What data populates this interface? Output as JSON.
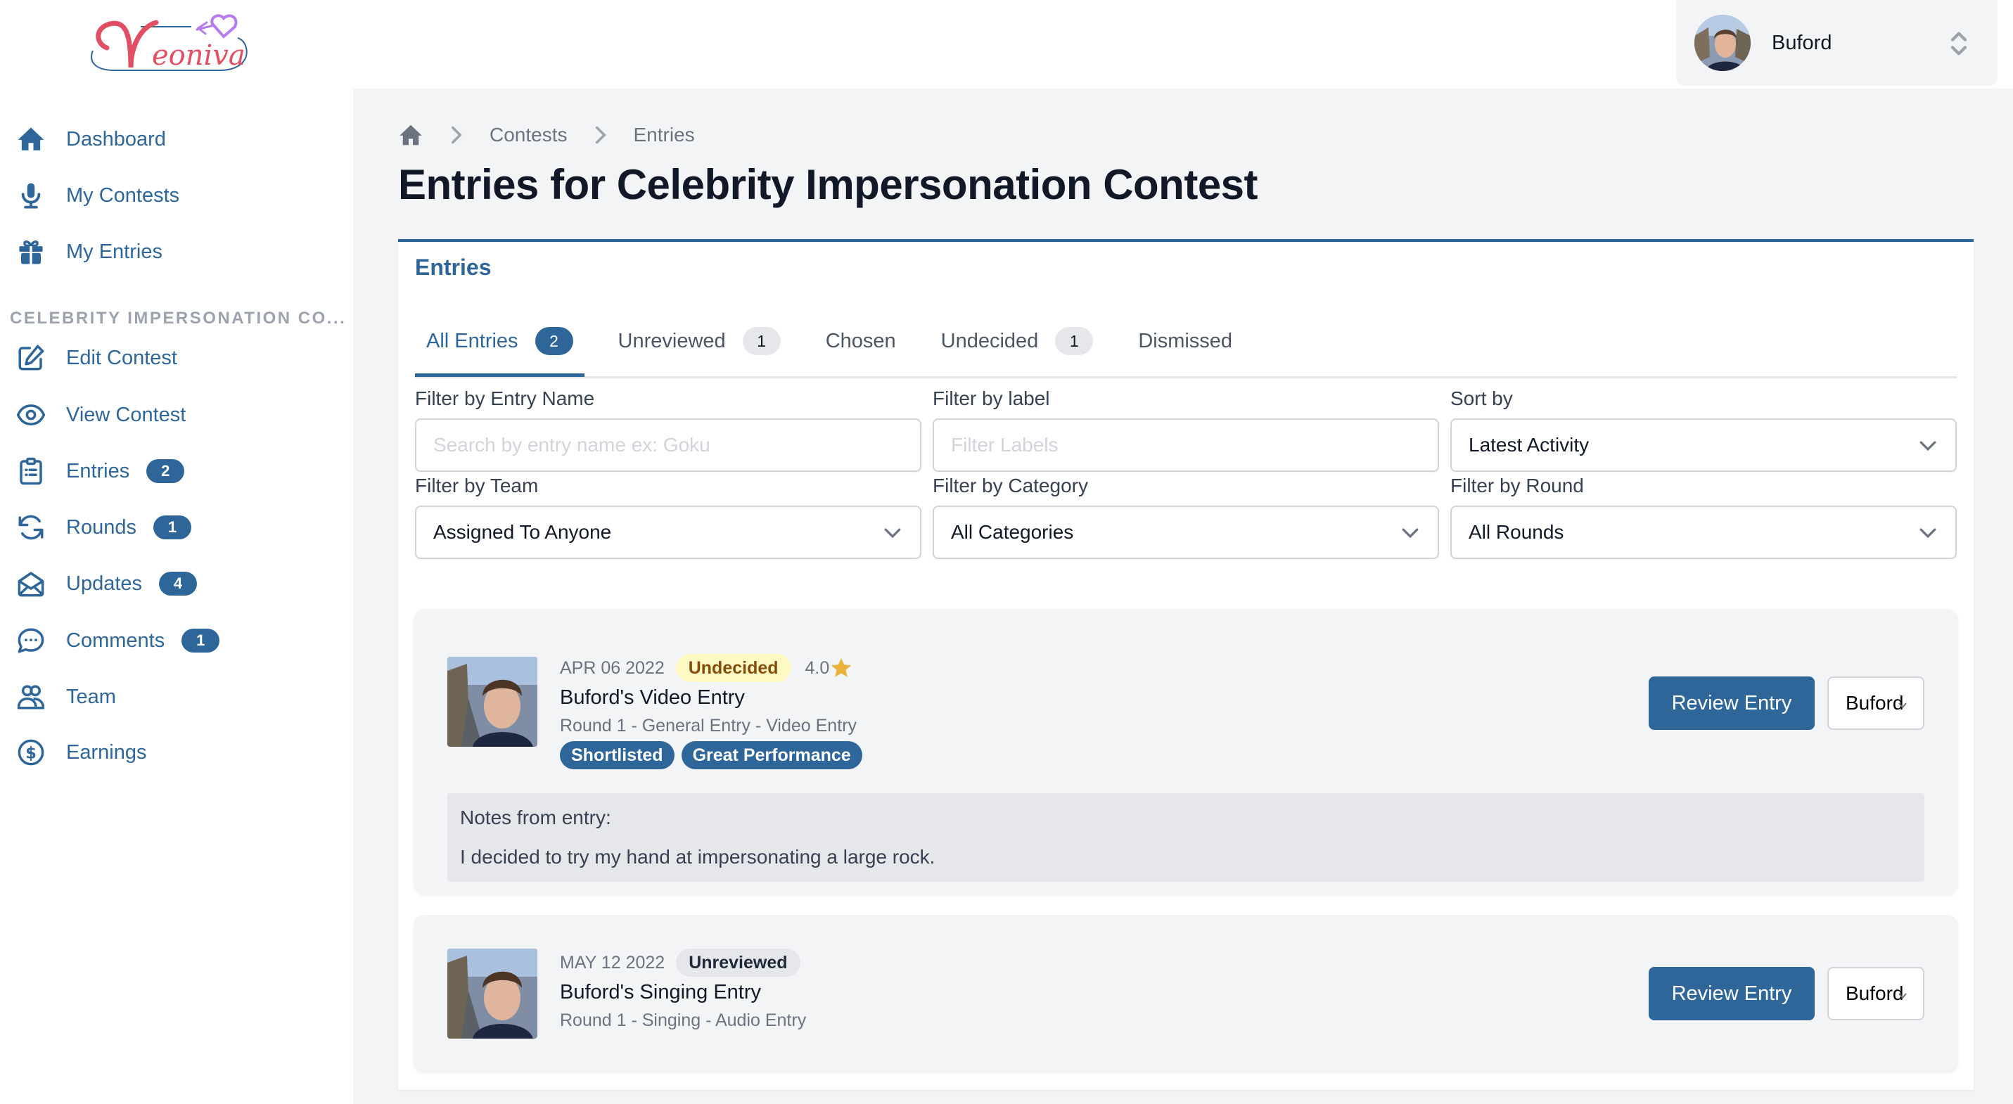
{
  "brand": {
    "name": "Neoniva",
    "colors": {
      "primary": "#2e6699",
      "logo_red": "#e04f63",
      "logo_purple": "#b57cf0"
    }
  },
  "sidebar": {
    "main_items": [
      {
        "label": "Dashboard",
        "icon": "home-icon"
      },
      {
        "label": "My Contests",
        "icon": "microphone-icon"
      },
      {
        "label": "My Entries",
        "icon": "gift-icon"
      }
    ],
    "section_title": "CELEBRITY IMPERSONATION CO...",
    "contest_items": [
      {
        "label": "Edit Contest",
        "icon": "edit-icon"
      },
      {
        "label": "View Contest",
        "icon": "eye-icon"
      },
      {
        "label": "Entries",
        "icon": "clipboard-list-icon",
        "badge": "2"
      },
      {
        "label": "Rounds",
        "icon": "refresh-icon",
        "badge": "1"
      },
      {
        "label": "Updates",
        "icon": "envelope-open-icon",
        "badge": "4"
      },
      {
        "label": "Comments",
        "icon": "chat-bubble-icon",
        "badge": "1"
      },
      {
        "label": "Team",
        "icon": "users-icon"
      },
      {
        "label": "Earnings",
        "icon": "dollar-circle-icon"
      }
    ]
  },
  "user_menu": {
    "name": "Buford"
  },
  "breadcrumb": {
    "items": [
      "Contests",
      "Entries"
    ]
  },
  "page": {
    "title": "Entries for Celebrity Impersonation Contest"
  },
  "panel": {
    "heading": "Entries",
    "tabs": [
      {
        "label": "All Entries",
        "count": "2",
        "active": true
      },
      {
        "label": "Unreviewed",
        "count": "1"
      },
      {
        "label": "Chosen"
      },
      {
        "label": "Undecided",
        "count": "1"
      },
      {
        "label": "Dismissed"
      }
    ],
    "filters": {
      "entry_name": {
        "label": "Filter by Entry Name",
        "value": "",
        "placeholder": "Search by entry name ex: Goku"
      },
      "label": {
        "label": "Filter by label",
        "value": "",
        "placeholder": "Filter Labels"
      },
      "sort": {
        "label": "Sort by",
        "selected": "Latest Activity"
      },
      "team": {
        "label": "Filter by Team",
        "selected": "Assigned To Anyone"
      },
      "category": {
        "label": "Filter by Category",
        "selected": "All Categories"
      },
      "round": {
        "label": "Filter by Round",
        "selected": "All Rounds"
      }
    },
    "entries": [
      {
        "date": "APR 06 2022",
        "status": "Undecided",
        "rating": "4.0",
        "title": "Buford's Video Entry",
        "subtitle": "Round 1 - General Entry - Video Entry",
        "labels": [
          "Shortlisted",
          "Great Performance"
        ],
        "notes_heading": "Notes from entry:",
        "notes": "I decided to try my hand at impersonating a large rock.",
        "review_label": "Review Entry",
        "assignee": "Buford"
      },
      {
        "date": "MAY 12 2022",
        "status": "Unreviewed",
        "title": "Buford's Singing Entry",
        "subtitle": "Round 1 - Singing - Audio Entry",
        "review_label": "Review Entry",
        "assignee": "Buford"
      }
    ]
  }
}
